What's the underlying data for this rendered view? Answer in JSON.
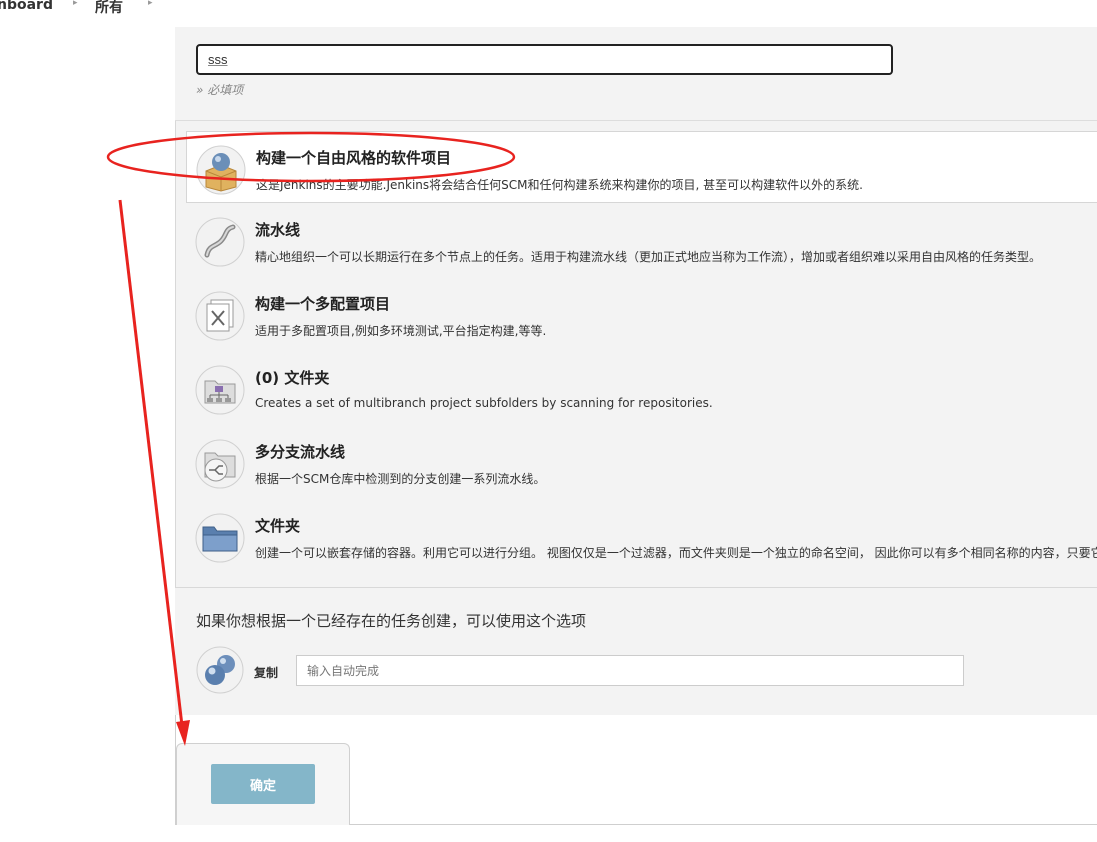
{
  "breadcrumb": {
    "items": [
      "nboard",
      "所有"
    ]
  },
  "name_field": {
    "value": "sss",
    "required_hint": "» 必填项"
  },
  "item_types": [
    {
      "title": "构建一个自由风格的软件项目",
      "description": "这是Jenkins的主要功能.Jenkins将会结合任何SCM和任何构建系统来构建你的项目, 甚至可以构建软件以外的系统.",
      "icon": "freestyle-project-icon",
      "selected": true
    },
    {
      "title": "流水线",
      "description": "精心地组织一个可以长期运行在多个节点上的任务。适用于构建流水线（更加正式地应当称为工作流），增加或者组织难以采用自由风格的任务类型。",
      "icon": "pipeline-icon",
      "selected": false
    },
    {
      "title": "构建一个多配置项目",
      "description": "适用于多配置项目,例如多环境测试,平台指定构建,等等.",
      "icon": "multi-config-project-icon",
      "selected": false
    },
    {
      "title": "(0) 文件夹",
      "description": "Creates a set of multibranch project subfolders by scanning for repositories.",
      "icon": "organization-folder-icon",
      "selected": false
    },
    {
      "title": "多分支流水线",
      "description": "根据一个SCM仓库中检测到的分支创建一系列流水线。",
      "icon": "multibranch-pipeline-icon",
      "selected": false
    },
    {
      "title": "文件夹",
      "description": "创建一个可以嵌套存储的容器。利用它可以进行分组。 视图仅仅是一个过滤器，而文件夹则是一个独立的命名空间， 因此你可以有多个相同名称的内容，只要它们在不同的文件夹里即可。",
      "icon": "folder-icon",
      "selected": false
    }
  ],
  "copy": {
    "title": "如果你想根据一个已经存在的任务创建，可以使用这个选项",
    "label": "复制",
    "placeholder": "输入自动完成",
    "icon": "copy-job-icon"
  },
  "ok_button": {
    "label": "确定"
  },
  "colors": {
    "panel_bg": "#f3f3f3",
    "ok_button": "#84b6c9",
    "annotation": "#e8231f"
  }
}
